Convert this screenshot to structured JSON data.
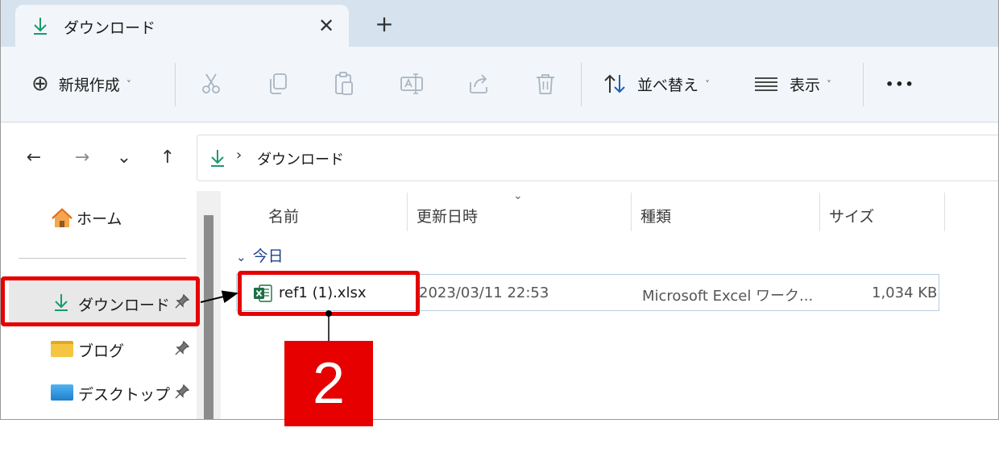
{
  "tab": {
    "title": "ダウンロード",
    "close_glyph": "✕",
    "new_tab_glyph": "+"
  },
  "toolbar": {
    "new_label": "新規作成",
    "new_icon_glyph": "⊕",
    "sort_label": "並べ替え",
    "view_label": "表示",
    "more_glyph": "•••",
    "chevron": "˅"
  },
  "nav": {
    "back_glyph": "←",
    "forward_glyph": "→",
    "recent_glyph": "⌄",
    "up_glyph": "↑"
  },
  "address": {
    "separator": "›",
    "location": "ダウンロード"
  },
  "sidebar": {
    "items": [
      {
        "label": "ホーム"
      },
      {
        "label": "ダウンロード",
        "pinned": true
      },
      {
        "label": "ブログ",
        "pinned": true
      },
      {
        "label": "デスクトップ",
        "pinned": true
      }
    ],
    "pin_glyph": "📌"
  },
  "columns": {
    "name": "名前",
    "modified": "更新日時",
    "type": "種類",
    "size": "サイズ",
    "sort_caret": "⌄"
  },
  "groups": [
    {
      "label": "今日",
      "chevron": "⌄",
      "files": [
        {
          "name": "ref1 (1).xlsx",
          "modified": "2023/03/11 22:53",
          "type": "Microsoft Excel ワーク...",
          "size": "1,034 KB"
        }
      ]
    }
  ],
  "annotation": {
    "step": "2"
  },
  "colors": {
    "accent_download": "#1a9a6c",
    "highlight": "#e60000",
    "tabstrip": "#d6e3ee",
    "toolbar": "#f2f6fa",
    "excel_green": "#1d7044",
    "folder_yellow": "#f5c542",
    "desktop_blue": "#2a8fd6"
  }
}
